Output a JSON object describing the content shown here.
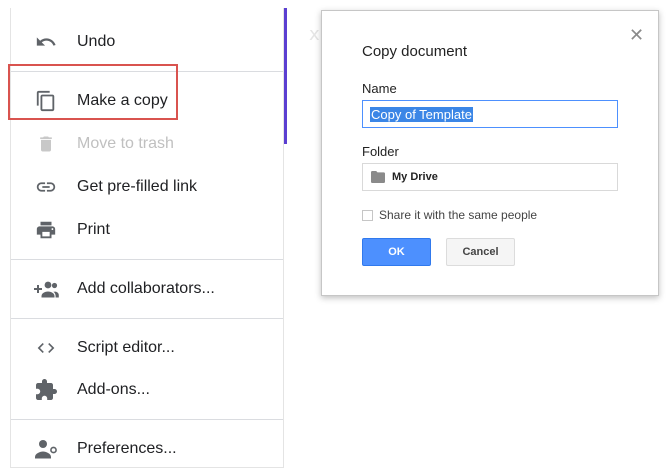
{
  "menu": {
    "items": [
      {
        "label": "Undo",
        "icon": "undo-icon",
        "enabled": true
      },
      {
        "label": "Make a copy",
        "icon": "copy-icon",
        "enabled": true,
        "highlighted": true
      },
      {
        "label": "Move to trash",
        "icon": "trash-icon",
        "enabled": false
      },
      {
        "label": "Get pre-filled link",
        "icon": "link-icon",
        "enabled": true
      },
      {
        "label": "Print",
        "icon": "print-icon",
        "enabled": true
      },
      {
        "label": "Add collaborators...",
        "icon": "add-people-icon",
        "enabled": true
      },
      {
        "label": "Script editor...",
        "icon": "code-icon",
        "enabled": true
      },
      {
        "label": "Add-ons...",
        "icon": "puzzle-icon",
        "enabled": true
      },
      {
        "label": "Preferences...",
        "icon": "person-settings-icon",
        "enabled": true
      }
    ],
    "highlight_color": "#d9534f",
    "accent_bar_color": "#5b3fd1"
  },
  "dialog": {
    "title": "Copy document",
    "close_glyph": "✕",
    "name_label": "Name",
    "name_value": "Copy of Template",
    "folder_label": "Folder",
    "folder_value": "My Drive",
    "share_label": "Share it with the same people",
    "share_checked": false,
    "ok_label": "OK",
    "cancel_label": "Cancel",
    "ok_color": "#4d90fe"
  }
}
